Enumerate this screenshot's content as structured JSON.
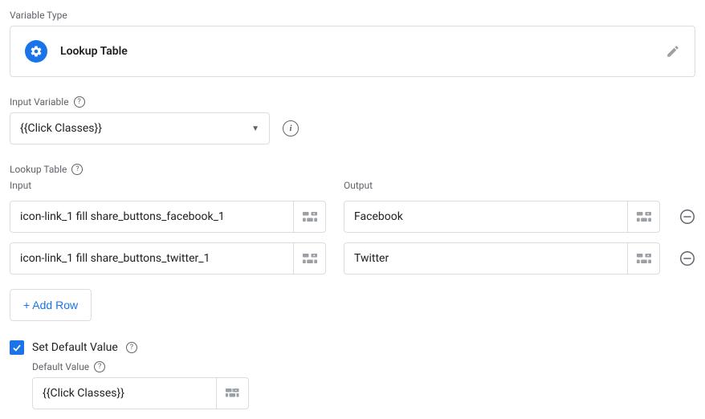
{
  "labels": {
    "variable_type": "Variable Type",
    "input_variable": "Input Variable",
    "lookup_table": "Lookup Table",
    "input_col": "Input",
    "output_col": "Output",
    "add_row": "+ Add Row",
    "set_default": "Set Default Value",
    "default_value": "Default Value"
  },
  "variable_type": {
    "name": "Lookup Table"
  },
  "input_variable": {
    "value": "{{Click Classes}}"
  },
  "rows": [
    {
      "input": "icon-link_1 fill share_buttons_facebook_1",
      "output": "Facebook"
    },
    {
      "input": "icon-link_1 fill share_buttons_twitter_1",
      "output": "Twitter"
    }
  ],
  "default": {
    "checked": true,
    "value": "{{Click Classes}}"
  }
}
